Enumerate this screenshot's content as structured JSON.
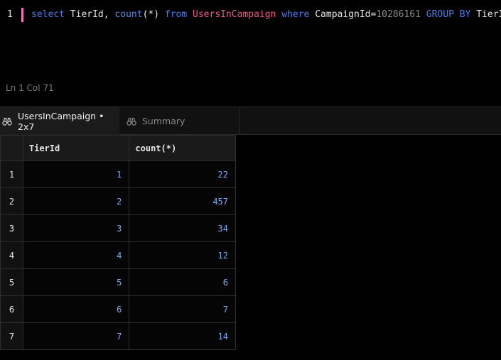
{
  "editor": {
    "line_number": "1",
    "tokens": [
      {
        "text": "select",
        "kind": "kw"
      },
      {
        "text": " ",
        "kind": "id"
      },
      {
        "text": "TierId,",
        "kind": "id"
      },
      {
        "text": " ",
        "kind": "id"
      },
      {
        "text": "count",
        "kind": "fn"
      },
      {
        "text": "(*)",
        "kind": "id"
      },
      {
        "text": " ",
        "kind": "id"
      },
      {
        "text": "from",
        "kind": "kw"
      },
      {
        "text": " ",
        "kind": "id"
      },
      {
        "text": "UsersInCampaign",
        "kind": "tbl"
      },
      {
        "text": " ",
        "kind": "id"
      },
      {
        "text": "where",
        "kind": "kw"
      },
      {
        "text": " ",
        "kind": "id"
      },
      {
        "text": "CampaignId=",
        "kind": "id"
      },
      {
        "text": "10286161",
        "kind": "num"
      },
      {
        "text": " ",
        "kind": "id"
      },
      {
        "text": "GROUP BY",
        "kind": "kw"
      },
      {
        "text": " ",
        "kind": "id"
      },
      {
        "text": "TierId;",
        "kind": "id"
      }
    ],
    "status": "Ln 1 Col 71"
  },
  "tabs": {
    "results": {
      "label": "UsersInCampaign • 2x7",
      "icon": "binoculars-icon"
    },
    "summary": {
      "label": "Summary",
      "icon": "binoculars-icon"
    }
  },
  "table": {
    "columns": [
      "TierId",
      "count(*)"
    ],
    "rows": [
      {
        "num": "1",
        "cells": [
          "1",
          "22"
        ]
      },
      {
        "num": "2",
        "cells": [
          "2",
          "457"
        ]
      },
      {
        "num": "3",
        "cells": [
          "3",
          "34"
        ]
      },
      {
        "num": "4",
        "cells": [
          "4",
          "12"
        ]
      },
      {
        "num": "5",
        "cells": [
          "5",
          "6"
        ]
      },
      {
        "num": "6",
        "cells": [
          "6",
          "7"
        ]
      },
      {
        "num": "7",
        "cells": [
          "7",
          "14"
        ]
      }
    ]
  },
  "colors": {
    "cursor": "#f472c0",
    "keyword": "#4d7cf0",
    "table_name": "#ec5a8a",
    "numeric_value": "#7fa8f5"
  }
}
